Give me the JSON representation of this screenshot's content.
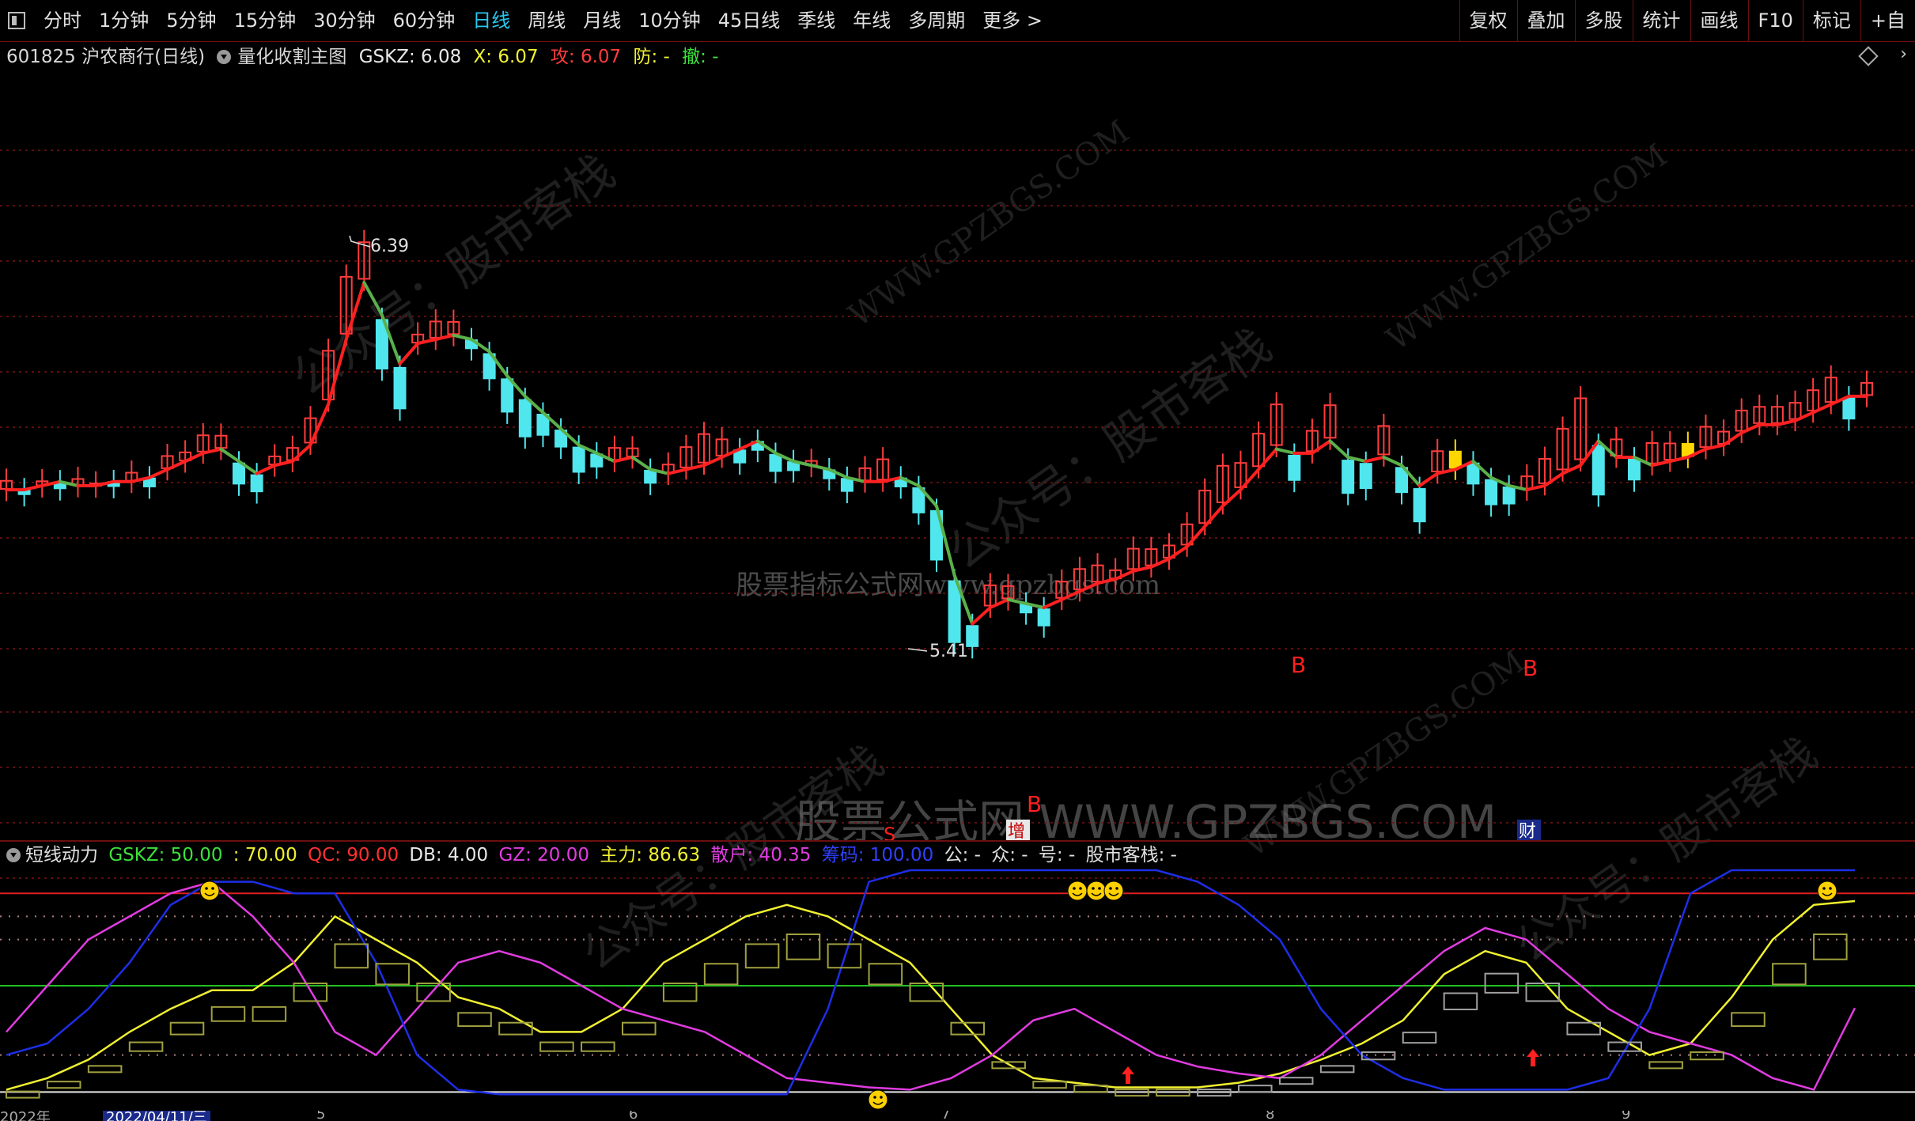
{
  "toolbar": {
    "periods": [
      "分时",
      "1分钟",
      "5分钟",
      "15分钟",
      "30分钟",
      "60分钟",
      "日线",
      "周线",
      "月线",
      "10分钟",
      "45日线",
      "季线",
      "年线",
      "多周期",
      "更多 >"
    ],
    "active_index": 6,
    "right_buttons": [
      "复权",
      "叠加",
      "多股",
      "统计",
      "画线",
      "F10",
      "标记",
      "+自"
    ]
  },
  "main_info": {
    "stock": "601825 沪农商行(日线)",
    "indicator": "量化收割主图",
    "gskz": "GSKZ: 6.08",
    "x": "X: 6.07",
    "gong": "攻: 6.07",
    "fang": "防: -",
    "che": "撤: -"
  },
  "main_labels": {
    "high": "6.39",
    "low": "5.41",
    "b1": "B",
    "b2": "B",
    "s": "S",
    "b3": "B",
    "zeng": "增",
    "cai": "财"
  },
  "sub_info": {
    "name": "短线动力",
    "gskz": "GSKZ: 50.00",
    "v70": ": 70.00",
    "qc": "QC: 90.00",
    "db": "DB: 4.00",
    "gz": "GZ: 20.00",
    "zhuli": "主力: 86.63",
    "sanhu": "散户: 40.35",
    "chouma": "筹码: 100.00",
    "gong": "公: -",
    "zhong": "众: -",
    "hao": "号: -",
    "kezhan": "股市客栈: -"
  },
  "date_axis": [
    "2022年",
    "2022/04/11/三",
    "5",
    "6",
    "7",
    "8",
    "9"
  ],
  "watermarks": {
    "site": "股票指标公式网www.gpzbgs.com",
    "big": "股票公式网 WWW.GPZBGS.COM",
    "gzh": "公众号：股市客栈",
    "url": "WWW.GPZBGS.COM"
  },
  "colors": {
    "up": "#ff3c3c",
    "down": "#50e6ee",
    "ma_up": "#ff2020",
    "ma_down": "#5ab04a",
    "grid": "#7a1212",
    "yellow": "#f0f030",
    "blue": "#1e2ee6",
    "magenta": "#e03ce0",
    "olive": "#a0a040"
  },
  "chart_data": [
    {
      "type": "candlestick",
      "title": "601825 沪农商行(日线)",
      "series": [
        {
          "name": "K线",
          "values": [
            5.79,
            5.79,
            5.8,
            5.81,
            5.8,
            5.8,
            5.81,
            5.81,
            5.82,
            5.84,
            5.86,
            5.88,
            5.89,
            5.86,
            5.83,
            5.85,
            5.86,
            5.9,
            6.0,
            6.16,
            6.3,
            6.22,
            6.1,
            6.15,
            6.16,
            6.17,
            6.16,
            6.13,
            6.07,
            6.02,
            5.98,
            5.94,
            5.9,
            5.88,
            5.86,
            5.87,
            5.84,
            5.83,
            5.84,
            5.85,
            5.87,
            5.89,
            5.91,
            5.88,
            5.86,
            5.85,
            5.84,
            5.82,
            5.81,
            5.81,
            5.82,
            5.8,
            5.75,
            5.58,
            5.46,
            5.5,
            5.52,
            5.51,
            5.5,
            5.52,
            5.54,
            5.56,
            5.57,
            5.59,
            5.6,
            5.62,
            5.65,
            5.7,
            5.75,
            5.79,
            5.84,
            5.89,
            5.88,
            5.88,
            5.91,
            5.87,
            5.86,
            5.87,
            5.85,
            5.8,
            5.83,
            5.84,
            5.86,
            5.82,
            5.8,
            5.79,
            5.8,
            5.83,
            5.85,
            5.91,
            5.87,
            5.87,
            5.85,
            5.86,
            5.87,
            5.89,
            5.9,
            5.93,
            5.95,
            5.95,
            5.96,
            5.98,
            6.0,
            6.02,
            6.02
          ]
        }
      ],
      "annotations": [
        "6.39",
        "5.41",
        "B",
        "B"
      ]
    },
    {
      "type": "line",
      "title": "短线动力",
      "series": [
        {
          "name": "主力",
          "values": [
            5,
            10,
            18,
            30,
            40,
            48,
            48,
            60,
            80,
            70,
            60,
            45,
            40,
            30,
            30,
            40,
            60,
            70,
            80,
            85,
            80,
            70,
            60,
            40,
            20,
            10,
            8,
            6,
            6,
            6,
            8,
            12,
            18,
            25,
            35,
            55,
            65,
            60,
            40,
            30,
            20,
            25,
            45,
            70,
            85,
            86.63
          ]
        },
        {
          "name": "散户",
          "values": [
            30,
            50,
            70,
            80,
            90,
            95,
            80,
            60,
            30,
            20,
            40,
            60,
            65,
            60,
            50,
            40,
            35,
            30,
            20,
            10,
            8,
            6,
            5,
            10,
            20,
            35,
            40,
            30,
            20,
            15,
            12,
            10,
            20,
            35,
            50,
            65,
            75,
            70,
            55,
            40,
            30,
            25,
            20,
            10,
            5,
            40.35
          ]
        },
        {
          "name": "筹码",
          "values": [
            20,
            25,
            40,
            60,
            85,
            95,
            95,
            90,
            90,
            60,
            20,
            5,
            3,
            3,
            3,
            3,
            3,
            3,
            3,
            3,
            40,
            95,
            100,
            100,
            100,
            100,
            100,
            100,
            100,
            95,
            85,
            70,
            40,
            20,
            10,
            5,
            5,
            5,
            5,
            10,
            40,
            90,
            100,
            100,
            100,
            100
          ]
        }
      ],
      "ylim": [
        0,
        100
      ]
    }
  ]
}
